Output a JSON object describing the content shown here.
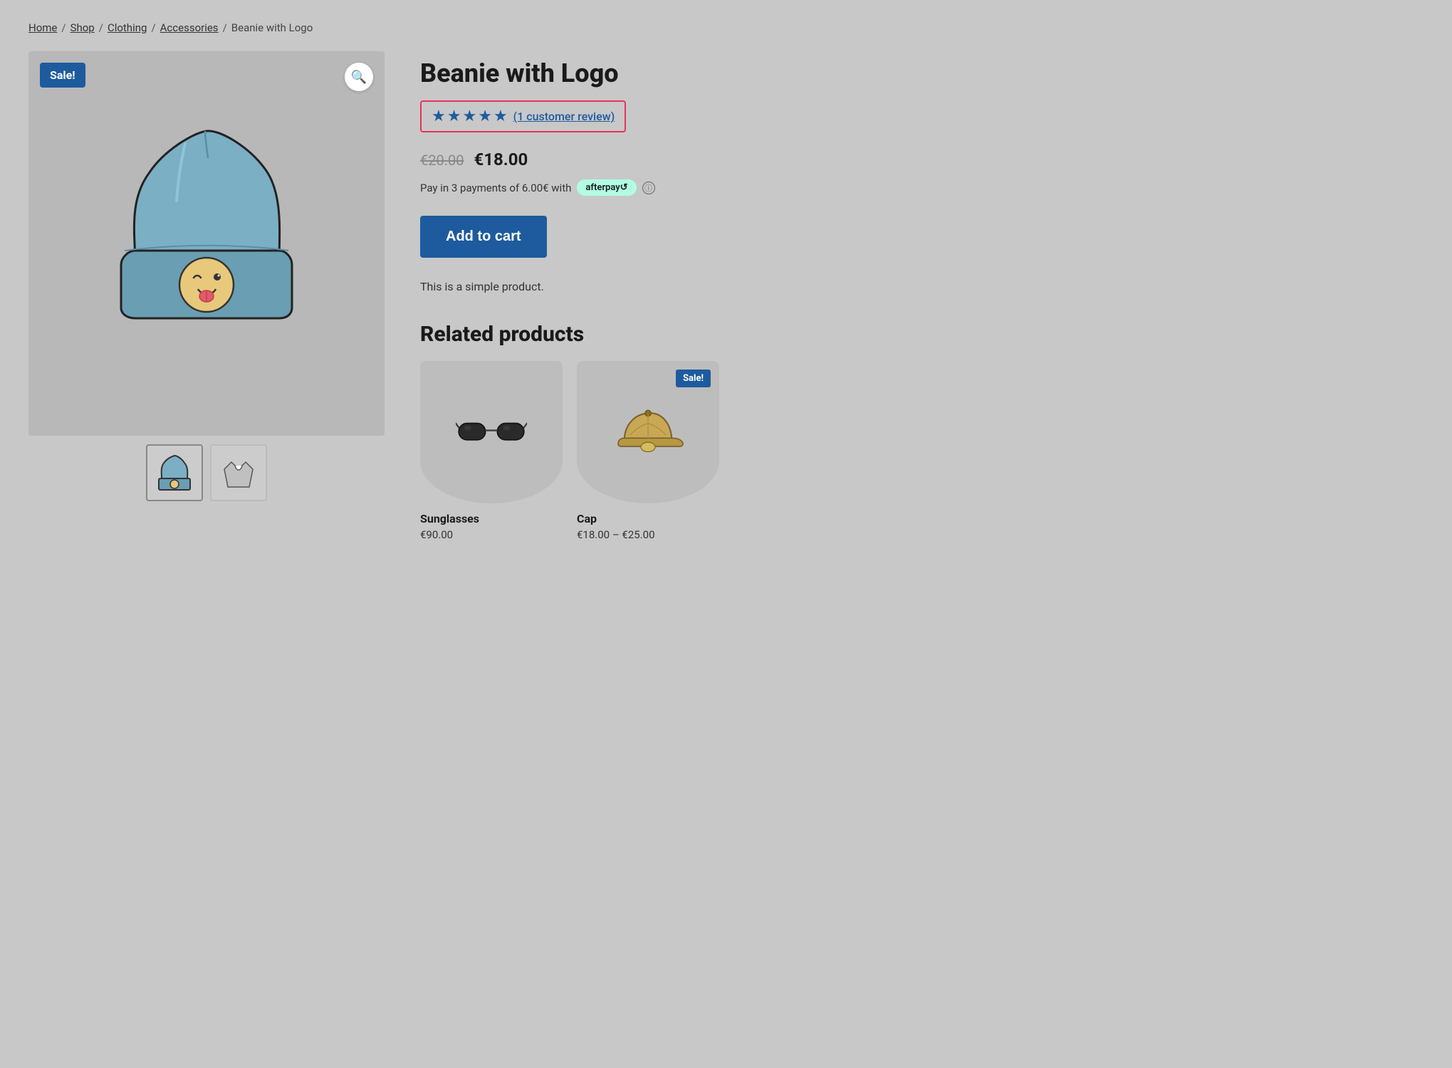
{
  "breadcrumb": {
    "home": "Home",
    "shop": "Shop",
    "clothing": "Clothing",
    "accessories": "Accessories",
    "current": "Beanie with Logo",
    "separator": "/"
  },
  "product": {
    "title": "Beanie with Logo",
    "sale_badge": "Sale!",
    "rating": {
      "stars": 5,
      "review_text": "(1 customer review)"
    },
    "old_price": "€20.00",
    "new_price": "€18.00",
    "afterpay_text": "Pay in 3 payments of 6.00€ with",
    "afterpay_label": "afterpay↺",
    "add_to_cart_label": "Add to cart",
    "description": "This is a simple product.",
    "zoom_icon": "🔍"
  },
  "related": {
    "section_title": "Related products",
    "products": [
      {
        "name": "Sunglasses",
        "price": "€90.00",
        "has_sale": false
      },
      {
        "name": "Cap",
        "price": "€18.00 – €25.00",
        "has_sale": true,
        "sale_label": "Sale!"
      }
    ]
  }
}
